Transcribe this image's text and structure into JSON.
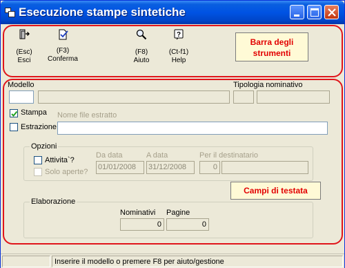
{
  "window": {
    "title": "Esecuzione stampe sintetiche"
  },
  "toolbar": {
    "items": [
      {
        "key": "(Esc)",
        "label": "Esci",
        "icon": "exit-door-icon"
      },
      {
        "key": "(F3)",
        "label": "Conferma",
        "icon": "confirm-check-icon"
      },
      {
        "key": "(F8)",
        "label": "Aiuto",
        "icon": "magnifier-icon"
      },
      {
        "key": "(Ct-f1)",
        "label": "Help",
        "icon": "help-question-icon"
      }
    ]
  },
  "annotations": {
    "toolbar_callout": "Barra degli strumenti",
    "header_callout": "Campi di testata",
    "highlight_color": "#e0141a"
  },
  "form": {
    "modello_label": "Modello",
    "modello_value": "",
    "tipologia_label": "Tipologia nominativo",
    "stampa_label": "Stampa",
    "stampa_checked": true,
    "nome_file_label": "Nome file estratto",
    "estrazione_label": "Estrazione",
    "estrazione_checked": false,
    "nome_file_value": ""
  },
  "opzioni": {
    "title": "Opzioni",
    "attivita_label": "Attivita`?",
    "solo_aperte_label": "Solo aperte?",
    "da_data_label": "Da data",
    "da_data_value": "01/01/2008",
    "a_data_label": "A data",
    "a_data_value": "31/12/2008",
    "destinatario_label": "Per il destinatario",
    "destinatario_value": "0"
  },
  "elaborazione": {
    "title": "Elaborazione",
    "nominativi_label": "Nominativi",
    "nominativi_value": "0",
    "pagine_label": "Pagine",
    "pagine_value": "0"
  },
  "status": {
    "message": "Inserire il modello o premere F8 per aiuto/gestione"
  }
}
